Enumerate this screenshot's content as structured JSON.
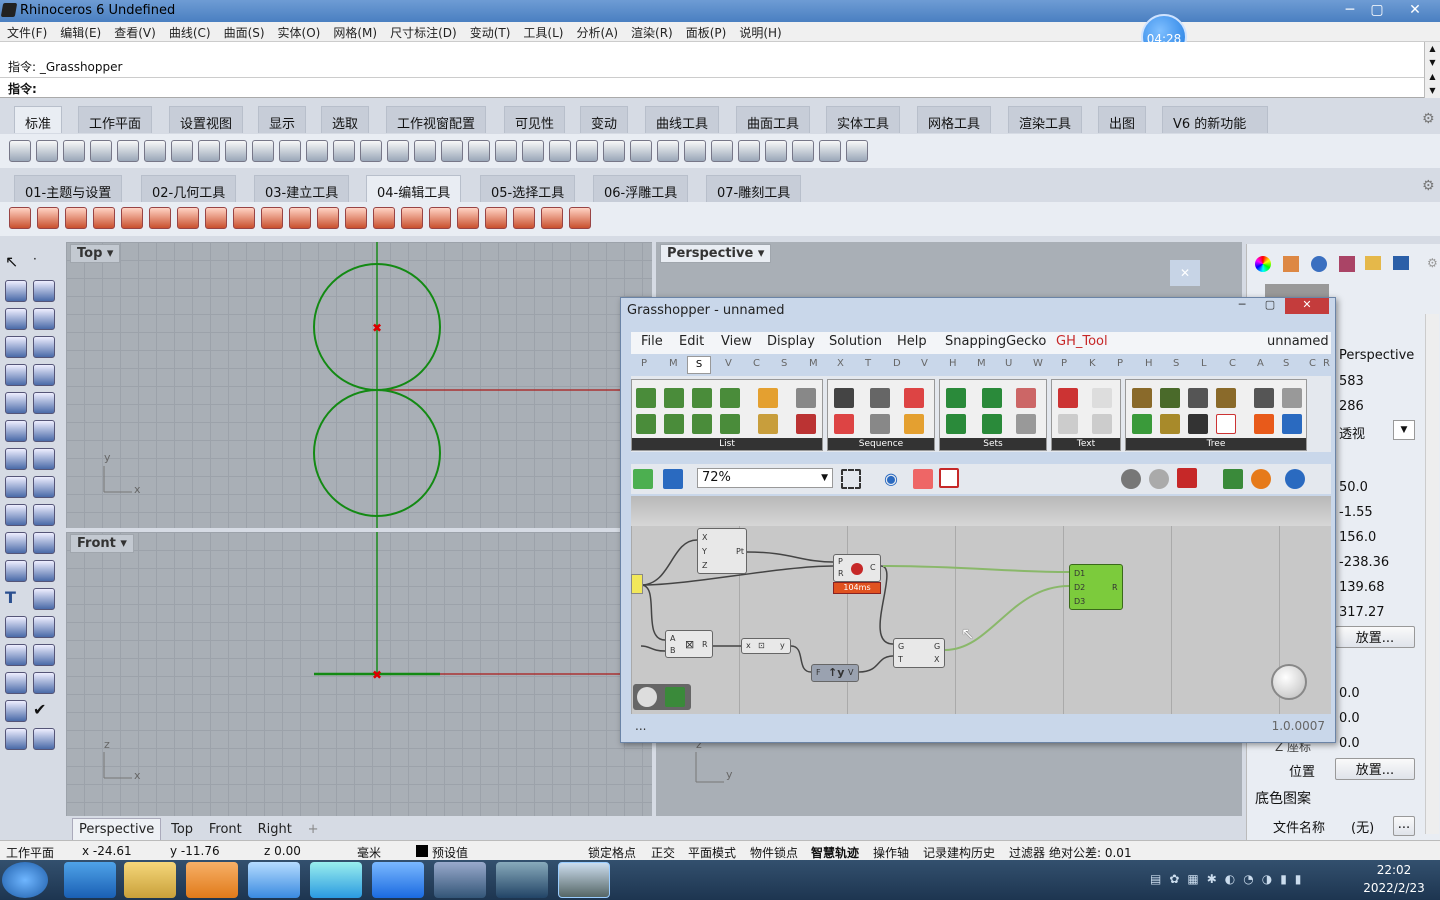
{
  "window": {
    "title": "Rhinoceros 6 Undefined",
    "minimize": "─",
    "maximize": "▢",
    "close": "✕"
  },
  "timer": "04:28",
  "menu": [
    "文件(F)",
    "编辑(E)",
    "查看(V)",
    "曲线(C)",
    "曲面(S)",
    "实体(O)",
    "网格(M)",
    "尺寸标注(D)",
    "变动(T)",
    "工具(L)",
    "分析(A)",
    "渲染(R)",
    "面板(P)",
    "说明(H)"
  ],
  "command": {
    "history_line": "指令: _Grasshopper",
    "prompt_label": "指令:",
    "prompt_value": ""
  },
  "toolbar_tabs": [
    "标准",
    "工作平面",
    "设置视图",
    "显示",
    "选取",
    "工作视窗配置",
    "可见性",
    "变动",
    "曲线工具",
    "曲面工具",
    "实体工具",
    "网格工具",
    "渲染工具",
    "出图",
    "V6 的新功能"
  ],
  "custom_tabs": [
    "01-主题与设置",
    "02-几何工具",
    "03-建立工具",
    "04-编辑工具",
    "05-选择工具",
    "06-浮雕工具",
    "07-雕刻工具"
  ],
  "viewports": {
    "top": {
      "label": "Top",
      "axis_x": "x",
      "axis_y": "y"
    },
    "front": {
      "label": "Front",
      "axis_x": "x",
      "axis_z": "z"
    },
    "perspective": {
      "label": "Perspective"
    },
    "right_axis_z": "z",
    "right_axis_y": "y"
  },
  "viewport_tabs": [
    "Perspective",
    "Top",
    "Front",
    "Right"
  ],
  "viewport_tab_add": "+",
  "status": {
    "cplane": "工作平面",
    "x": "x -24.61",
    "y": "y -11.76",
    "z": "z 0.00",
    "unit": "毫米",
    "layer": "预设值",
    "items": [
      "锁定格点",
      "正交",
      "平面模式",
      "物件锁点",
      "智慧轨迹",
      "操作轴",
      "记录建构历史",
      "过滤器",
      "绝对公差: 0.01"
    ]
  },
  "taskbar": {
    "time": "22:02",
    "date": "2022/2/23"
  },
  "properties": {
    "view_name": "Perspective",
    "width": "583",
    "height": "286",
    "projection": "透视",
    "values": [
      "50.0",
      "-1.55",
      "156.0",
      "-238.36",
      "139.68",
      "317.27"
    ],
    "place_button": "放置...",
    "zeros": [
      "0.0",
      "0.0",
      "0.0"
    ],
    "zlabel": "Z 座标",
    "position_label": "位置",
    "position_button": "放置...",
    "bg_heading": "底色图案",
    "filename_label": "文件名称",
    "filename_value": "(无)",
    "more": "..."
  },
  "grasshopper": {
    "title": "Grasshopper - unnamed",
    "menu": [
      "File",
      "Edit",
      "View",
      "Display",
      "Solution",
      "Help",
      "SnappingGecko",
      "GH_Tool"
    ],
    "doc_name": "unnamed",
    "subtabs": [
      "P",
      "M",
      "S",
      "V",
      "C",
      "S",
      "M",
      "X",
      "T",
      "D",
      "V",
      "H",
      "M",
      "U",
      "W",
      "P",
      "K",
      "P",
      "H",
      "S",
      "L",
      "C",
      "A",
      "S",
      "C",
      "R"
    ],
    "groups": [
      "List",
      "Sequence",
      "Sets",
      "Text",
      "Tree"
    ],
    "zoom": "72%",
    "timing": "104ms",
    "version": "1.0.0007",
    "footer": "...",
    "colors": {
      "accent": "#c62828",
      "param": "#f2e85a",
      "active_comp": "#7ccb3c",
      "wire": "#8ab86a"
    }
  }
}
